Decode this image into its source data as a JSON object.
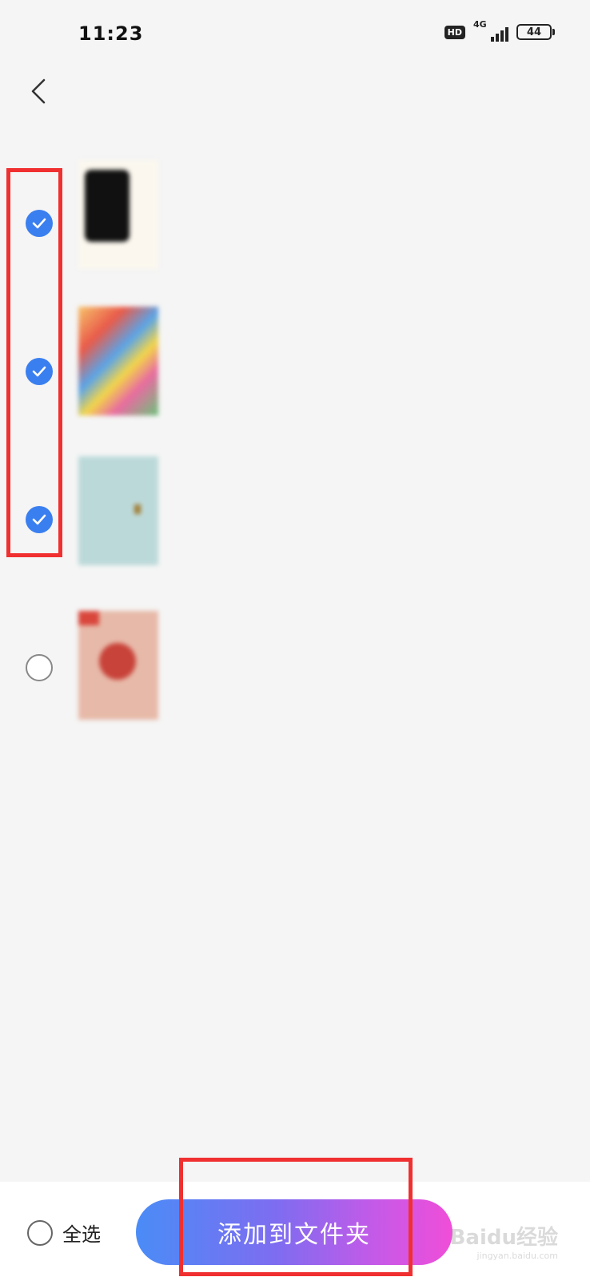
{
  "status_bar": {
    "time": "11:23",
    "hd_badge": "HD",
    "network": "4G",
    "battery": "44"
  },
  "header": {
    "title": "",
    "back_icon": "chevron-left-icon"
  },
  "list": {
    "items": [
      {
        "name": "",
        "date": "",
        "selected": true
      },
      {
        "name": "",
        "date": "",
        "selected": true
      },
      {
        "name": "",
        "date": "",
        "selected": true
      },
      {
        "name": "",
        "date": "",
        "selected": false
      }
    ]
  },
  "bottom_bar": {
    "select_all_label": "全选",
    "add_button_label": "添加到文件夹"
  },
  "watermark": {
    "brand": "Baidu经验",
    "url": "jingyan.baidu.com"
  },
  "colors": {
    "accent": "#3a7ff0",
    "annotation": "#f03030",
    "button_gradient_start": "#4a8cf7",
    "button_gradient_end": "#f04ed8"
  }
}
